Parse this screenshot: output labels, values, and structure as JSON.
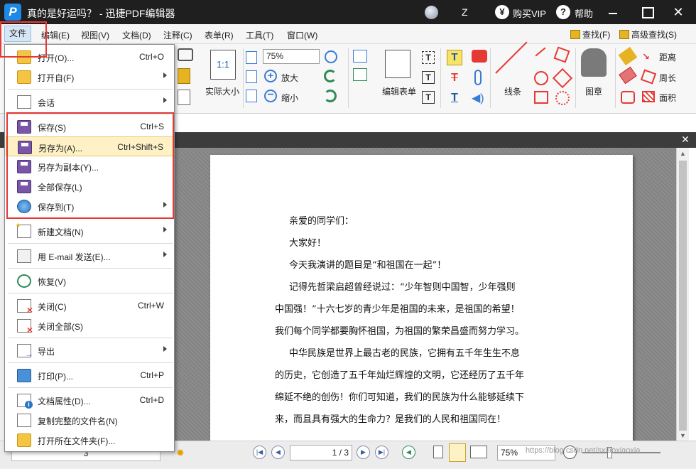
{
  "app": {
    "title": "真的是好运吗？ - 迅捷PDF编辑器",
    "logo_letter": "P",
    "user": "Z",
    "vip_label": "购买VIP",
    "vip_symbol": "¥",
    "help_label": "帮助",
    "help_symbol": "?",
    "close_symbol": "✕"
  },
  "menubar": {
    "items": [
      "文件",
      "编辑(E)",
      "视图(V)",
      "文档(D)",
      "注释(C)",
      "表单(R)",
      "工具(T)",
      "窗口(W)"
    ],
    "find": "查找(F)",
    "adv_find": "高级查找(S)"
  },
  "toolbar": {
    "zoom_value": "75%",
    "actual_size": "实际大小",
    "actual_size_icon": "1:1",
    "zoom_in": "放大",
    "zoom_out": "缩小",
    "edit_form": "编辑表单",
    "line": "线条",
    "stamp": "图章",
    "distance": "距离",
    "perimeter": "周长",
    "area": "面积",
    "text_icon": "T"
  },
  "file_menu": {
    "open": {
      "label": "打开(O)...",
      "shortcut": "Ctrl+O"
    },
    "open_from": {
      "label": "打开自(F)"
    },
    "session": {
      "label": "会话"
    },
    "save": {
      "label": "保存(S)",
      "shortcut": "Ctrl+S"
    },
    "save_as": {
      "label": "另存为(A)...",
      "shortcut": "Ctrl+Shift+S"
    },
    "save_copy": {
      "label": "另存为副本(Y)..."
    },
    "save_all": {
      "label": "全部保存(L)"
    },
    "save_to": {
      "label": "保存到(T)"
    },
    "new_doc": {
      "label": "新建文档(N)"
    },
    "email": {
      "label": "用 E-mail 发送(E)..."
    },
    "restore": {
      "label": "恢复(V)"
    },
    "close": {
      "label": "关闭(C)",
      "shortcut": "Ctrl+W"
    },
    "close_all": {
      "label": "关闭全部(S)"
    },
    "export": {
      "label": "导出"
    },
    "print": {
      "label": "打印(P)...",
      "shortcut": "Ctrl+P"
    },
    "properties": {
      "label": "文档属性(D)...",
      "shortcut": "Ctrl+D"
    },
    "copy_name": {
      "label": "复制完整的文件名(N)"
    },
    "open_folder": {
      "label": "打开所在文件夹(F)..."
    }
  },
  "document": {
    "lines": [
      "亲爱的同学们：",
      "大家好！",
      "今天我演讲的题目是“和祖国在一起”！",
      "记得先哲梁启超曾经说过：“少年智则中国智，少年强则",
      "中国强！”十六七岁的青少年是祖国的未来，是祖国的希望！",
      "我们每个同学都要胸怀祖国，为祖国的繁荣昌盛而努力学习。",
      "中华民族是世界上最古老的民族，它拥有五千年生生不息",
      "的历史，它创造了五千年灿烂辉煌的文明，它还经历了五千年",
      "绵延不绝的创伤！你们可知道，我们的民族为什么能够延续下",
      "来，而且具有强大的生命力？是我们的人民和祖国同在！"
    ]
  },
  "statusbar": {
    "page_display": "1 / 3",
    "zoom_value": "75%",
    "left_page_number": "3",
    "watermark": "https://blog.csdn.net/sxiaoxiaoxia"
  },
  "colors": {
    "titlebar": "#1f1f1f",
    "highlight": "#fdf1c5",
    "annotation_red": "#e53935",
    "accent_blue": "#1e88e5"
  }
}
